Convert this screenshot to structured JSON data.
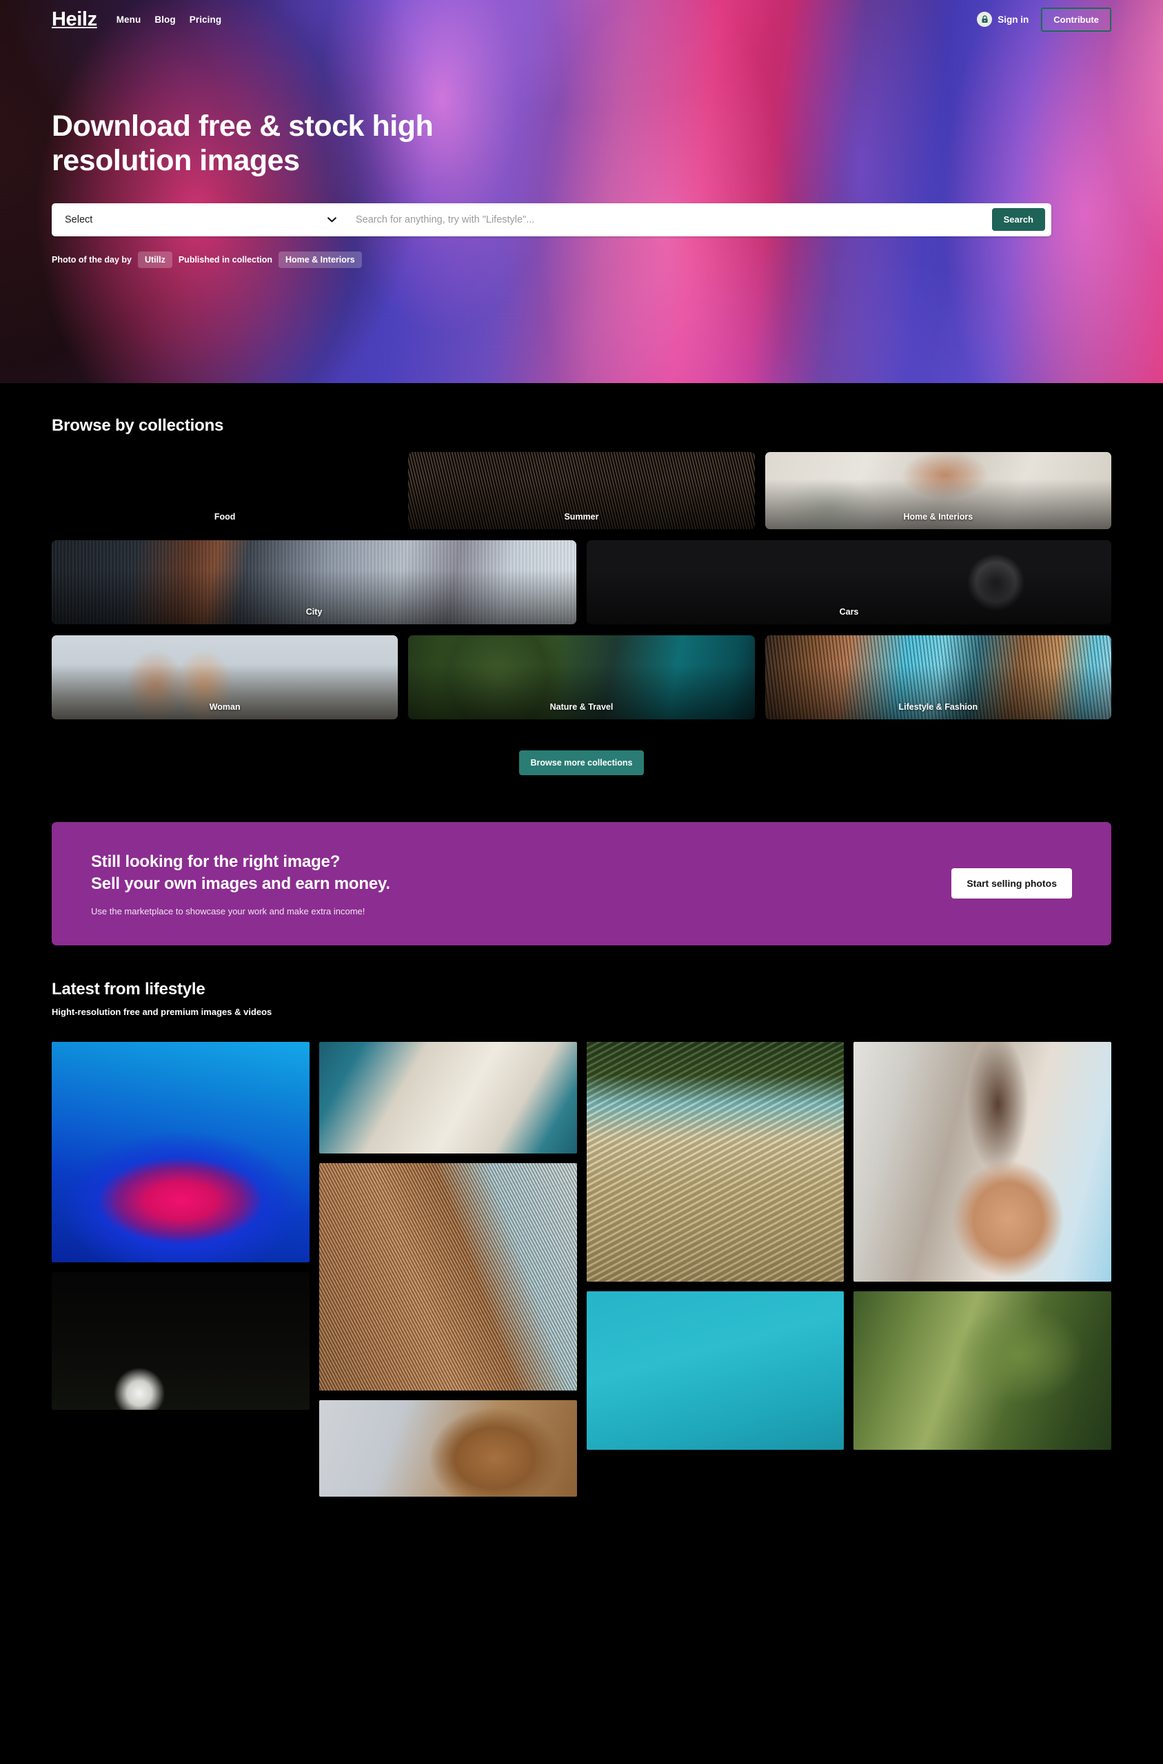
{
  "nav": {
    "logo": "Heilz",
    "links": [
      {
        "label": "Menu"
      },
      {
        "label": "Blog"
      },
      {
        "label": "Pricing"
      }
    ],
    "signin_label": "Sign in",
    "signin_icon": "lock-icon",
    "contribute_label": "Contribute"
  },
  "hero": {
    "title": "Download free & stock high resolution images",
    "search": {
      "select_value": "Select",
      "select_options": [
        "Select"
      ],
      "placeholder": "Search for anything, try with \"Lifestyle\"...",
      "button_label": "Search",
      "chevron_icon": "chevron-down-icon"
    },
    "photo_of_the_day": {
      "prefix": "Photo of the day by",
      "author": "Utillz",
      "middle": "Published in collection",
      "collection": "Home & Interiors"
    }
  },
  "collections": {
    "title": "Browse by collections",
    "rows": [
      [
        {
          "label": "Food",
          "art": "art-food"
        },
        {
          "label": "Summer",
          "art": "art-summer"
        },
        {
          "label": "Home & Interiors",
          "art": "art-home"
        }
      ],
      [
        {
          "label": "City",
          "art": "art-city"
        },
        {
          "label": "Cars",
          "art": "art-cars"
        }
      ],
      [
        {
          "label": "Woman",
          "art": "art-woman"
        },
        {
          "label": "Nature & Travel",
          "art": "art-nature"
        },
        {
          "label": "Lifestyle & Fashion",
          "art": "art-lifestyle"
        }
      ]
    ],
    "browse_more_label": "Browse more collections"
  },
  "promo": {
    "line1": "Still looking for the right image?",
    "line2": "Sell your own images and earn money.",
    "subtitle": "Use the marketplace to showcase your work and make extra income!",
    "button_label": "Start selling photos",
    "background_color": "#8c2d91"
  },
  "latest": {
    "title": "Latest from lifestyle",
    "subtitle": "Hight-resolution free and premium images & videos",
    "columns": [
      [
        {
          "art": "ph-agate"
        },
        {
          "art": "ph-dark"
        }
      ],
      [
        {
          "art": "ph-pool"
        },
        {
          "art": "ph-umbrella"
        },
        {
          "art": "ph-horse"
        }
      ],
      [
        {
          "art": "ph-palm"
        },
        {
          "art": "ph-water"
        }
      ],
      [
        {
          "art": "ph-woman"
        },
        {
          "art": "ph-banana"
        }
      ]
    ]
  },
  "colors": {
    "page_background": "#000000",
    "accent_teal": "#1f6257",
    "accent_teal_light": "#2a7d74",
    "promo_purple": "#8c2d91",
    "contribute_border": "#1f6a5a"
  }
}
